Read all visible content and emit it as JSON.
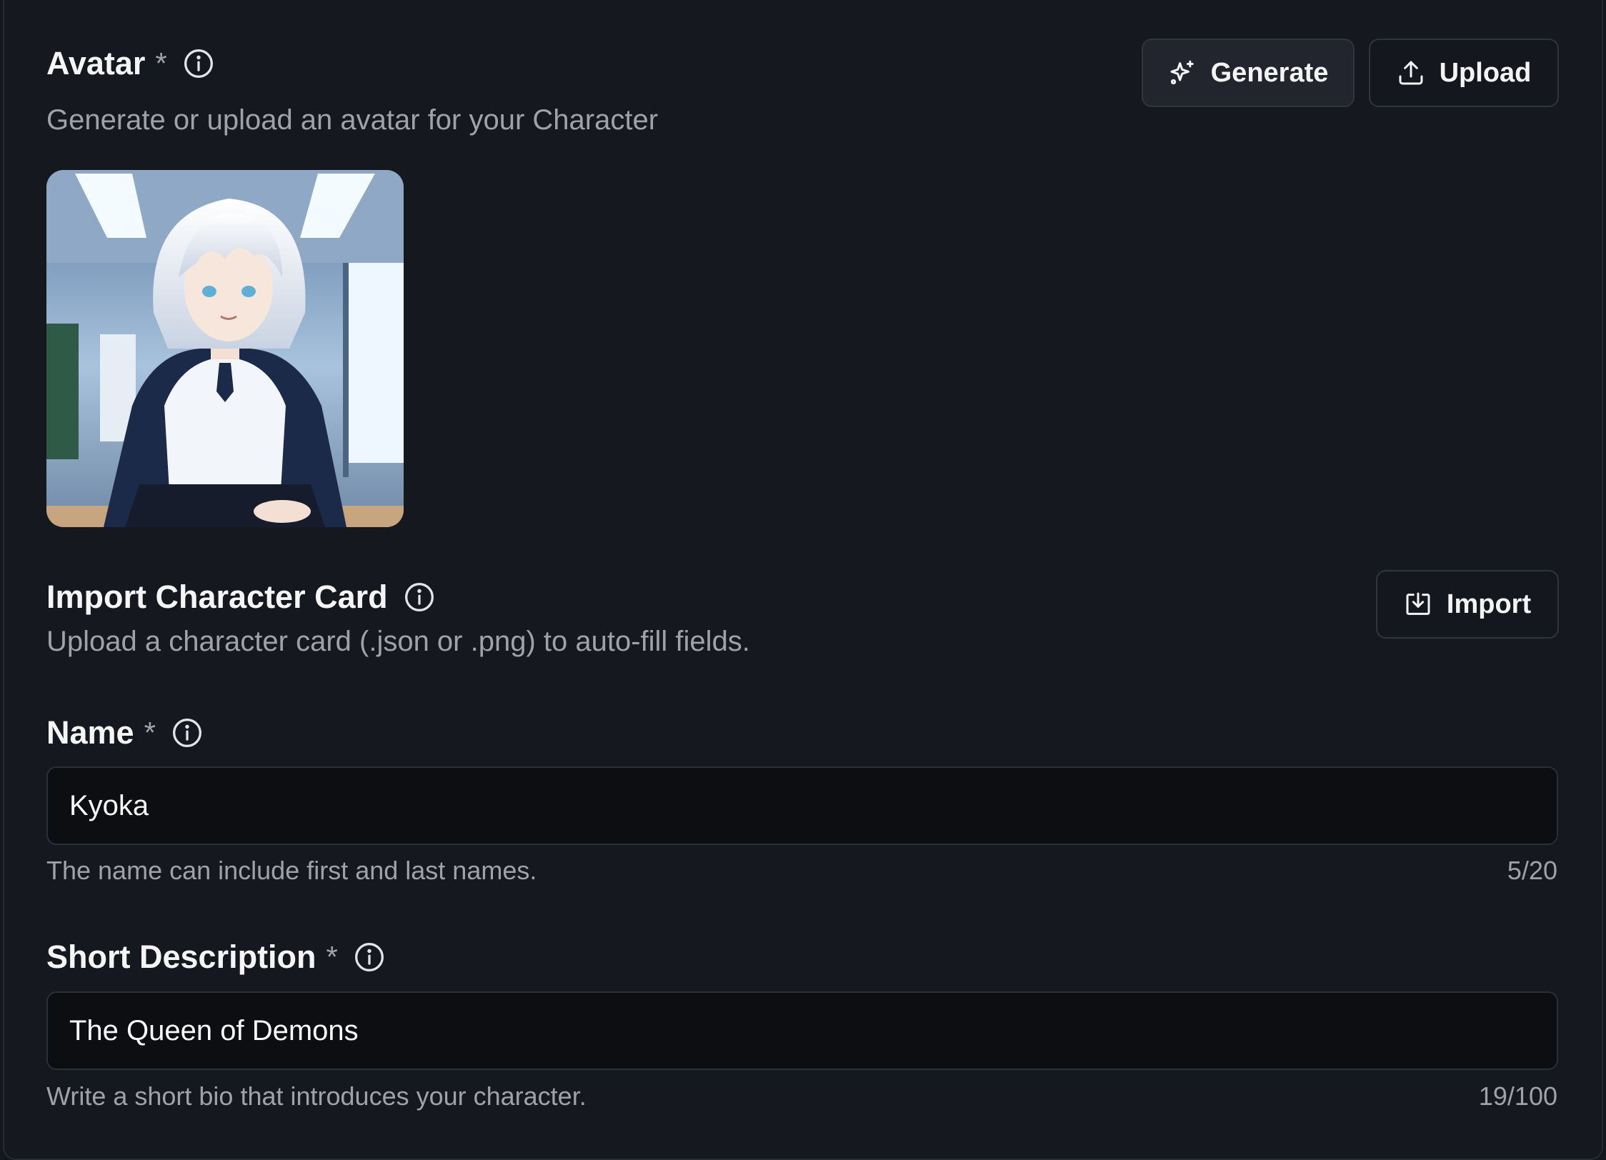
{
  "avatar_section": {
    "label": "Avatar",
    "required_mark": "*",
    "description": "Generate or upload an avatar for your Character",
    "generate_label": "Generate",
    "upload_label": "Upload",
    "avatar_image_alt": "Character avatar"
  },
  "import_section": {
    "label": "Import Character Card",
    "description": "Upload a character card (.json or .png) to auto-fill fields.",
    "import_label": "Import"
  },
  "name_field": {
    "label": "Name",
    "required_mark": "*",
    "value": "Kyoka",
    "helper": "The name can include first and last names.",
    "counter": "5/20"
  },
  "short_description_field": {
    "label": "Short Description",
    "required_mark": "*",
    "value": "The Queen of Demons",
    "helper": "Write a short bio that introduces your character.",
    "counter": "19/100"
  },
  "colors": {
    "background": "#14171d",
    "input_background": "#0d0e12",
    "muted_text": "#a1a1aa"
  },
  "icons": {
    "info": "info-icon",
    "generate": "sparkles-icon",
    "upload": "upload-icon",
    "import": "import-icon"
  }
}
